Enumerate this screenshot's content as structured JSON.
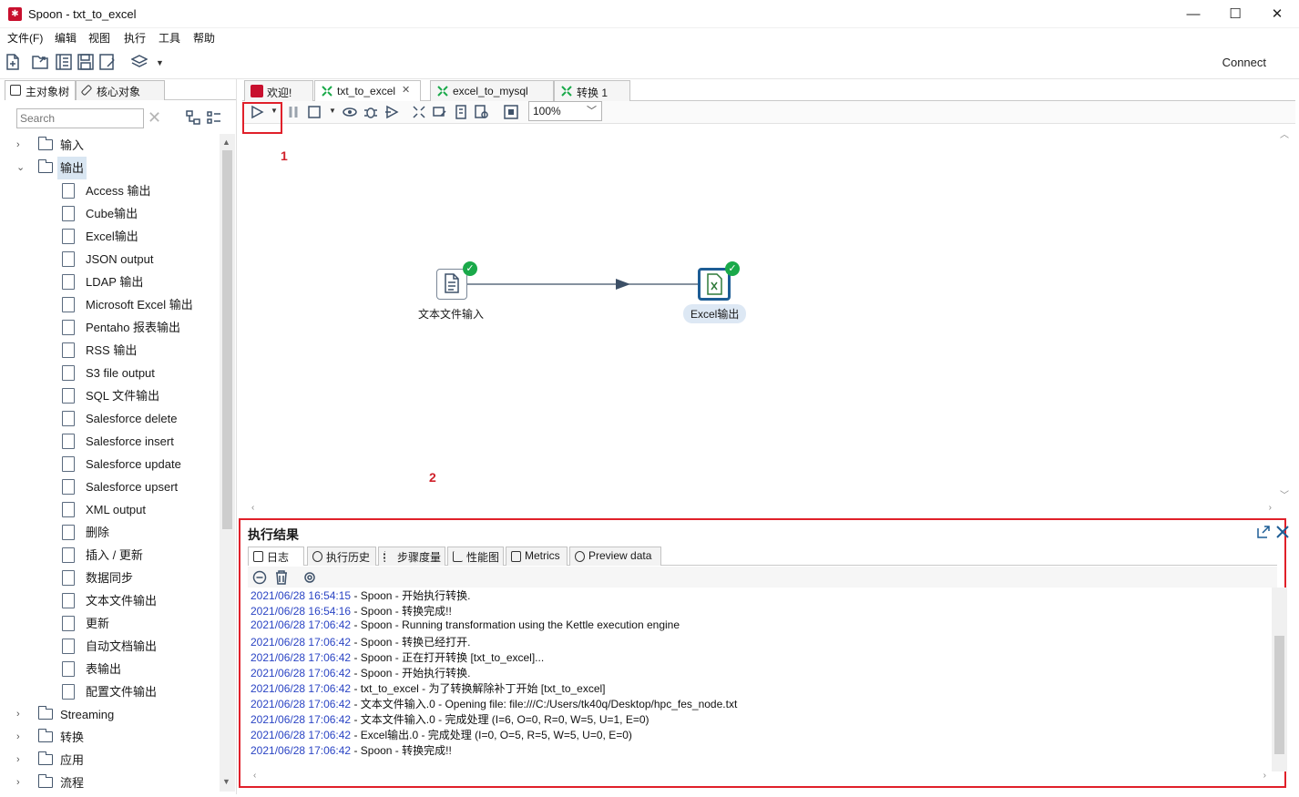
{
  "window": {
    "title": "Spoon - txt_to_excel",
    "controls": {
      "minimize": "—",
      "maximize": "☐",
      "close": "✕"
    }
  },
  "menu": [
    "文件(F)",
    "编辑",
    "视图",
    "执行",
    "工具",
    "帮助"
  ],
  "toolbar": {
    "connect_label": "Connect"
  },
  "left_panel": {
    "tabs": [
      "主对象树",
      "核心对象"
    ],
    "search_placeholder": "Search",
    "tree": [
      {
        "label": "输入",
        "expanded": false
      },
      {
        "label": "输出",
        "expanded": true,
        "selected": true
      },
      {
        "label": "Access 输出",
        "child": true
      },
      {
        "label": "Cube输出",
        "child": true
      },
      {
        "label": "Excel输出",
        "child": true
      },
      {
        "label": "JSON output",
        "child": true
      },
      {
        "label": "LDAP 输出",
        "child": true
      },
      {
        "label": "Microsoft Excel 输出",
        "child": true
      },
      {
        "label": "Pentaho 报表输出",
        "child": true
      },
      {
        "label": "RSS 输出",
        "child": true
      },
      {
        "label": "S3 file output",
        "child": true
      },
      {
        "label": "SQL 文件输出",
        "child": true
      },
      {
        "label": "Salesforce delete",
        "child": true
      },
      {
        "label": "Salesforce insert",
        "child": true
      },
      {
        "label": "Salesforce update",
        "child": true
      },
      {
        "label": "Salesforce upsert",
        "child": true
      },
      {
        "label": "XML output",
        "child": true
      },
      {
        "label": "删除",
        "child": true
      },
      {
        "label": "插入 / 更新",
        "child": true
      },
      {
        "label": "数据同步",
        "child": true
      },
      {
        "label": "文本文件输出",
        "child": true
      },
      {
        "label": "更新",
        "child": true
      },
      {
        "label": "自动文档输出",
        "child": true
      },
      {
        "label": "表输出",
        "child": true
      },
      {
        "label": "配置文件输出",
        "child": true
      },
      {
        "label": "Streaming",
        "expanded": false
      },
      {
        "label": "转换",
        "expanded": false
      },
      {
        "label": "应用",
        "expanded": false
      },
      {
        "label": "流程",
        "expanded": false
      }
    ]
  },
  "editor_tabs": [
    {
      "label": "欢迎!",
      "active": false
    },
    {
      "label": "txt_to_excel",
      "active": true,
      "close": "✕"
    },
    {
      "label": "excel_to_mysql",
      "active": false
    },
    {
      "label": "转换 1",
      "active": false
    }
  ],
  "canvas_toolbar": {
    "zoom": "100%"
  },
  "annotations": {
    "marker_1": "1",
    "marker_2": "2"
  },
  "canvas": {
    "nodes": [
      {
        "label": "文本文件输入",
        "status": "ok"
      },
      {
        "label": "Excel输出",
        "status": "ok",
        "selected": true
      }
    ]
  },
  "results": {
    "title": "执行结果",
    "tabs": [
      "日志",
      "执行历史",
      "步骤度量",
      "性能图",
      "Metrics",
      "Preview data"
    ],
    "log": [
      {
        "ts": "2021/06/28 16:54:15",
        "msg": " - Spoon - 开始执行转换."
      },
      {
        "ts": "2021/06/28 16:54:16",
        "msg": " - Spoon - 转换完成!!"
      },
      {
        "ts": "2021/06/28 17:06:42",
        "msg": " - Spoon - Running transformation using the Kettle execution engine"
      },
      {
        "ts": "2021/06/28 17:06:42",
        "msg": " - Spoon - 转换已经打开."
      },
      {
        "ts": "2021/06/28 17:06:42",
        "msg": " - Spoon - 正在打开转换 [txt_to_excel]..."
      },
      {
        "ts": "2021/06/28 17:06:42",
        "msg": " - Spoon - 开始执行转换."
      },
      {
        "ts": "2021/06/28 17:06:42",
        "msg": " - txt_to_excel - 为了转换解除补丁开始  [txt_to_excel]"
      },
      {
        "ts": "2021/06/28 17:06:42",
        "msg": " - 文本文件输入.0 - Opening file: file:///C:/Users/tk40q/Desktop/hpc_fes_node.txt"
      },
      {
        "ts": "2021/06/28 17:06:42",
        "msg": " - 文本文件输入.0 - 完成处理 (I=6, O=0, R=0, W=5, U=1, E=0)"
      },
      {
        "ts": "2021/06/28 17:06:42",
        "msg": " - Excel输出.0 - 完成处理 (I=0, O=5, R=5, W=5, U=0, E=0)"
      },
      {
        "ts": "2021/06/28 17:06:42",
        "msg": " - Spoon - 转换完成!!"
      }
    ]
  }
}
